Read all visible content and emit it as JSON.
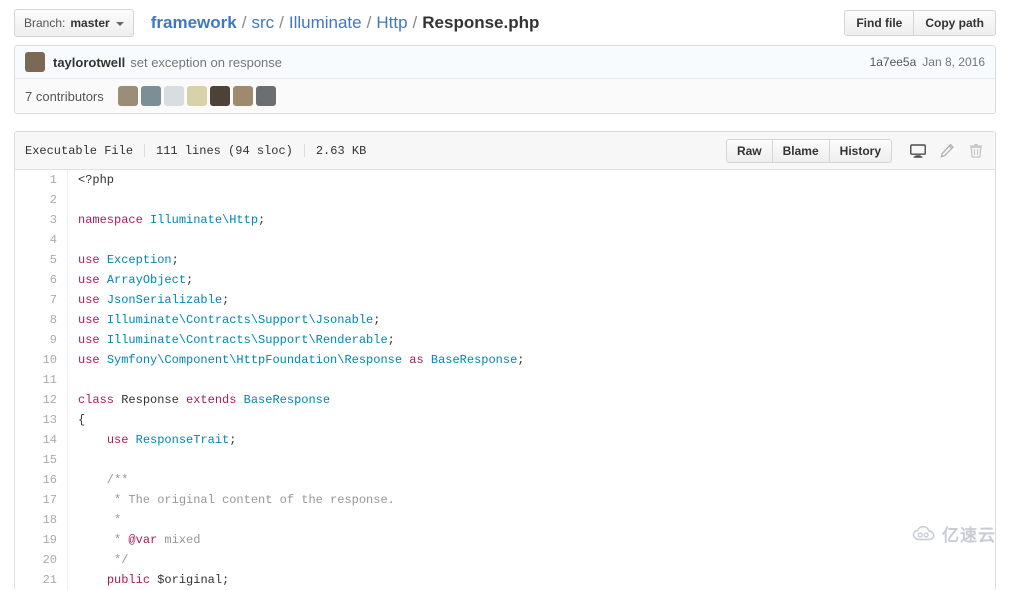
{
  "topbar": {
    "branch_prefix": "Branch:",
    "branch_name": "master",
    "breadcrumb": {
      "repo": "framework",
      "crumbs": [
        "src",
        "Illuminate",
        "Http"
      ],
      "file": "Response.php",
      "separator": "/"
    },
    "find_file_label": "Find file",
    "copy_path_label": "Copy path"
  },
  "commit": {
    "author": "taylorotwell",
    "message": "set exception on response",
    "sha": "1a7ee5a",
    "date": "Jan 8, 2016",
    "avatar_color": "#7a6a55"
  },
  "contributors": {
    "label": "7 contributors",
    "count": 7,
    "avatar_colors": [
      "#9a8e78",
      "#7b8f96",
      "#d8dde0",
      "#d9d2a8",
      "#4d4138",
      "#a08a6e",
      "#6b6f72"
    ]
  },
  "file": {
    "mode_label": "Executable File",
    "lines_label": "111 lines (94 sloc)",
    "size_label": "2.63 KB",
    "raw_label": "Raw",
    "blame_label": "Blame",
    "history_label": "History",
    "desktop_icon": "desktop-icon",
    "edit_icon": "pencil-icon",
    "delete_icon": "trash-icon"
  },
  "code": {
    "language": "php",
    "lines": [
      {
        "n": 1,
        "tokens": [
          {
            "t": "<?php",
            "c": "p"
          }
        ]
      },
      {
        "n": 2,
        "tokens": []
      },
      {
        "n": 3,
        "tokens": [
          {
            "t": "namespace",
            "c": "k"
          },
          {
            "t": " ",
            "c": "p"
          },
          {
            "t": "Illuminate\\Http",
            "c": "n"
          },
          {
            "t": ";",
            "c": "p"
          }
        ]
      },
      {
        "n": 4,
        "tokens": []
      },
      {
        "n": 5,
        "tokens": [
          {
            "t": "use",
            "c": "k"
          },
          {
            "t": " ",
            "c": "p"
          },
          {
            "t": "Exception",
            "c": "n"
          },
          {
            "t": ";",
            "c": "p"
          }
        ]
      },
      {
        "n": 6,
        "tokens": [
          {
            "t": "use",
            "c": "k"
          },
          {
            "t": " ",
            "c": "p"
          },
          {
            "t": "ArrayObject",
            "c": "n"
          },
          {
            "t": ";",
            "c": "p"
          }
        ]
      },
      {
        "n": 7,
        "tokens": [
          {
            "t": "use",
            "c": "k"
          },
          {
            "t": " ",
            "c": "p"
          },
          {
            "t": "JsonSerializable",
            "c": "n"
          },
          {
            "t": ";",
            "c": "p"
          }
        ]
      },
      {
        "n": 8,
        "tokens": [
          {
            "t": "use",
            "c": "k"
          },
          {
            "t": " ",
            "c": "p"
          },
          {
            "t": "Illuminate\\Contracts\\Support\\Jsonable",
            "c": "n"
          },
          {
            "t": ";",
            "c": "p"
          }
        ]
      },
      {
        "n": 9,
        "tokens": [
          {
            "t": "use",
            "c": "k"
          },
          {
            "t": " ",
            "c": "p"
          },
          {
            "t": "Illuminate\\Contracts\\Support\\Renderable",
            "c": "n"
          },
          {
            "t": ";",
            "c": "p"
          }
        ]
      },
      {
        "n": 10,
        "tokens": [
          {
            "t": "use",
            "c": "k"
          },
          {
            "t": " ",
            "c": "p"
          },
          {
            "t": "Symfony\\Component\\HttpFoundation\\Response",
            "c": "n"
          },
          {
            "t": " ",
            "c": "p"
          },
          {
            "t": "as",
            "c": "k"
          },
          {
            "t": " ",
            "c": "p"
          },
          {
            "t": "BaseResponse",
            "c": "n"
          },
          {
            "t": ";",
            "c": "p"
          }
        ]
      },
      {
        "n": 11,
        "tokens": []
      },
      {
        "n": 12,
        "tokens": [
          {
            "t": "class",
            "c": "k"
          },
          {
            "t": " Response ",
            "c": "p"
          },
          {
            "t": "extends",
            "c": "k"
          },
          {
            "t": " ",
            "c": "p"
          },
          {
            "t": "BaseResponse",
            "c": "n"
          }
        ]
      },
      {
        "n": 13,
        "tokens": [
          {
            "t": "{",
            "c": "p"
          }
        ]
      },
      {
        "n": 14,
        "tokens": [
          {
            "t": "    ",
            "c": "p"
          },
          {
            "t": "use",
            "c": "k"
          },
          {
            "t": " ",
            "c": "p"
          },
          {
            "t": "ResponseTrait",
            "c": "n"
          },
          {
            "t": ";",
            "c": "p"
          }
        ]
      },
      {
        "n": 15,
        "tokens": []
      },
      {
        "n": 16,
        "tokens": [
          {
            "t": "    /**",
            "c": "c"
          }
        ]
      },
      {
        "n": 17,
        "tokens": [
          {
            "t": "     * The original content of the response.",
            "c": "c"
          }
        ]
      },
      {
        "n": 18,
        "tokens": [
          {
            "t": "     *",
            "c": "c"
          }
        ]
      },
      {
        "n": 19,
        "tokens": [
          {
            "t": "     * ",
            "c": "c"
          },
          {
            "t": "@var",
            "c": "cd"
          },
          {
            "t": " mixed",
            "c": "c"
          }
        ]
      },
      {
        "n": 20,
        "tokens": [
          {
            "t": "     */",
            "c": "c"
          }
        ]
      },
      {
        "n": 21,
        "tokens": [
          {
            "t": "    ",
            "c": "p"
          },
          {
            "t": "public",
            "c": "k"
          },
          {
            "t": " ",
            "c": "p"
          },
          {
            "t": "$original",
            "c": "v"
          },
          {
            "t": ";",
            "c": "p"
          }
        ]
      }
    ]
  },
  "watermark": {
    "text": "亿速云",
    "icon": "cloud-icon"
  }
}
